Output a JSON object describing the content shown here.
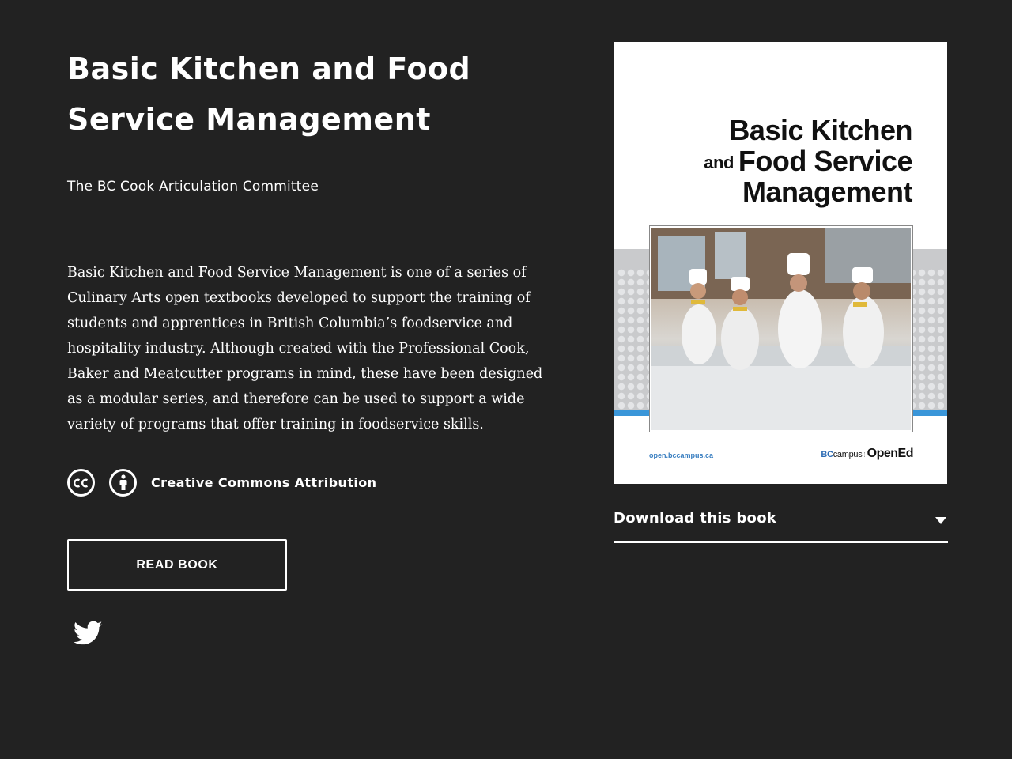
{
  "book": {
    "title": "Basic Kitchen and Food Service Management",
    "author": "The BC Cook Articulation Committee",
    "description": "Basic Kitchen and Food Service Management is one of a series of Culinary Arts open textbooks developed to support the training of students and apprentices in British Columbia’s foodservice and hospitality industry. Although created with the Professional Cook, Baker and Meatcutter programs in mind, these have been designed as a modular series, and therefore can be used to support a wide variety of programs that offer training in foodservice skills."
  },
  "license": {
    "label": "Creative Commons Attribution",
    "icons": [
      "cc-icon",
      "attribution-icon"
    ]
  },
  "actions": {
    "read_label": "READ BOOK",
    "download_label": "Download this book",
    "share_icon": "twitter-icon"
  },
  "cover": {
    "title_line1": "Basic Kitchen",
    "title_and": "and",
    "title_line2": "Food Service",
    "title_line3": "Management",
    "url": "open.bccampus.ca",
    "brand_bc": "BC",
    "brand_campus": "campus",
    "brand_opened": "OpenEd",
    "accent_color": "#3a96d9"
  },
  "colors": {
    "background": "#222222",
    "text": "#ffffff"
  }
}
